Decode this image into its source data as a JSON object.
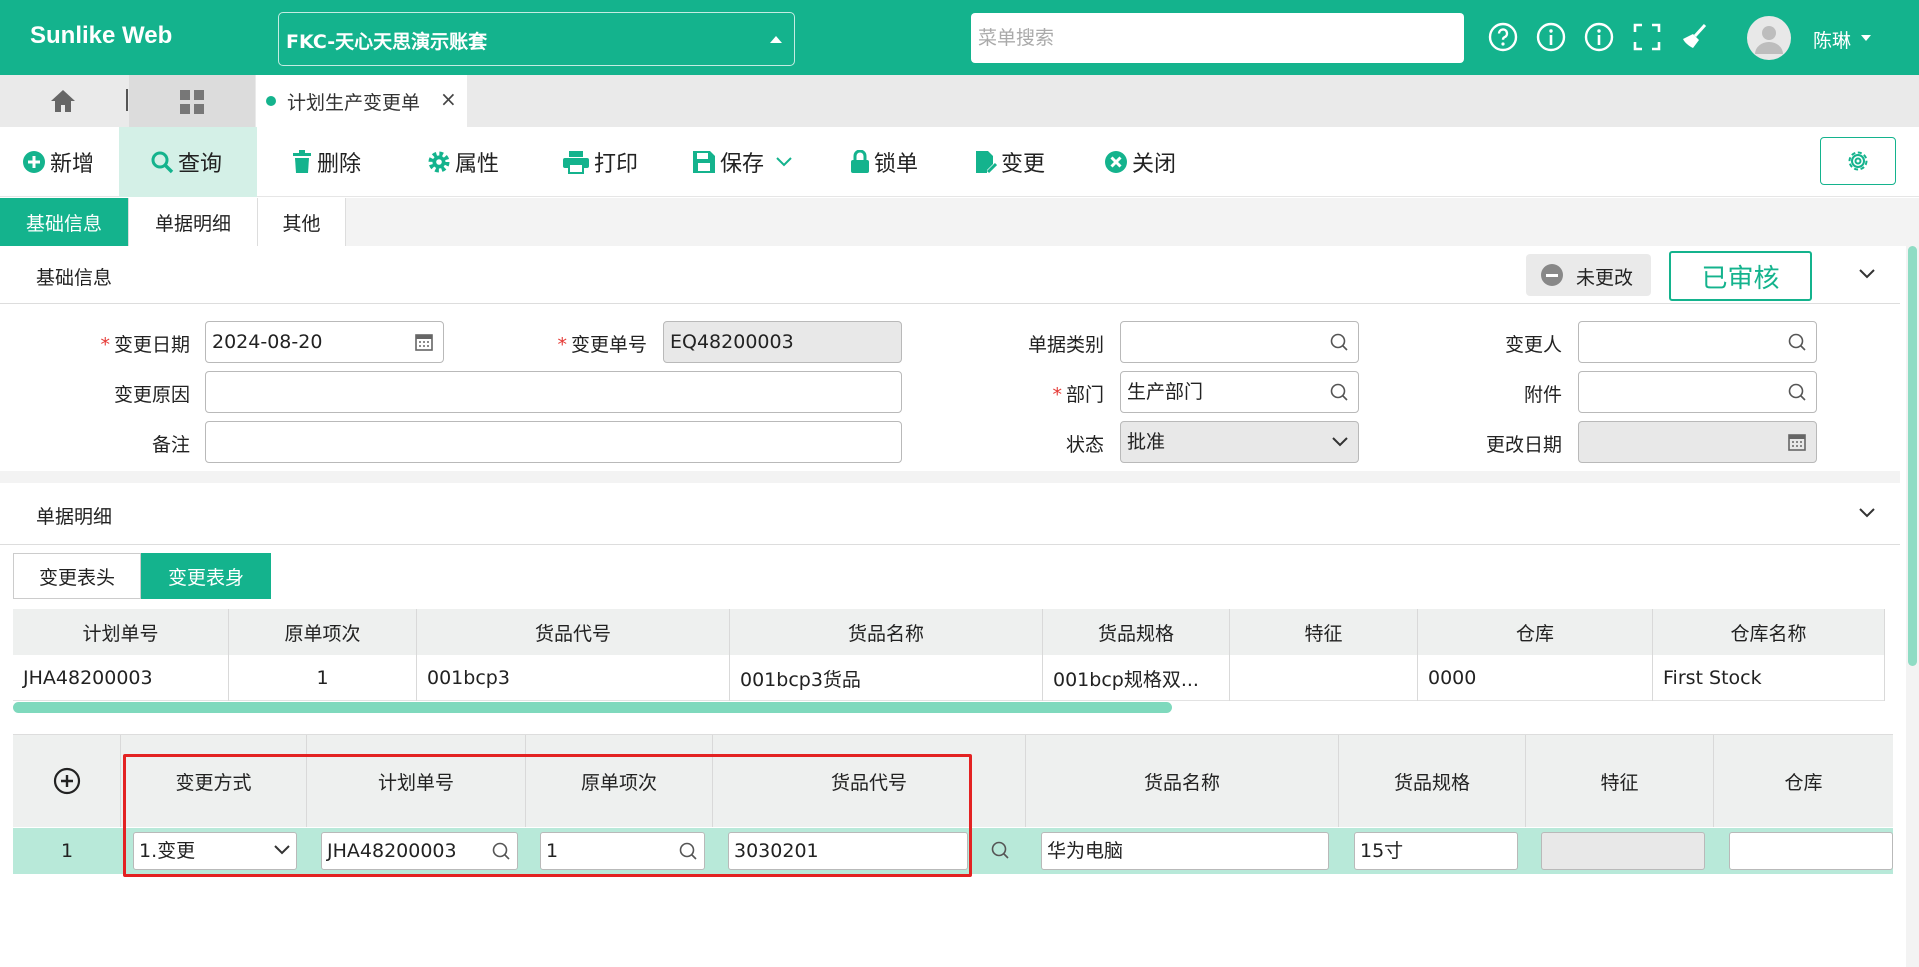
{
  "header": {
    "brand": "Sunlike Web",
    "account": "FKC-天心天思演示账套",
    "search_placeholder": "菜单搜索",
    "username": "陈琳"
  },
  "tabs": {
    "active_doc": "计划生产变更单"
  },
  "toolbar": {
    "new": "新增",
    "query": "查询",
    "delete": "删除",
    "attr": "属性",
    "print": "打印",
    "save": "保存",
    "lock": "锁单",
    "change": "变更",
    "close": "关闭"
  },
  "subtabs": [
    "基础信息",
    "单据明细",
    "其他"
  ],
  "basic": {
    "title": "基础信息",
    "unchanged": "未更改",
    "approved": "已审核",
    "labels": {
      "change_date": "变更日期",
      "change_no": "变更单号",
      "doc_type": "单据类别",
      "changer": "变更人",
      "reason": "变更原因",
      "dept": "部门",
      "attachment": "附件",
      "remark": "备注",
      "status": "状态",
      "modify_date": "更改日期"
    },
    "values": {
      "change_date": "2024-08-20",
      "change_no": "EQ48200003",
      "doc_type": "",
      "changer": "",
      "reason": "",
      "dept": "生产部门",
      "attachment": "",
      "remark": "",
      "status": "批准",
      "modify_date": ""
    }
  },
  "detail": {
    "title": "单据明细",
    "inner_tabs": [
      "变更表头",
      "变更表身"
    ],
    "head_grid": {
      "columns": [
        "计划单号",
        "原单项次",
        "货品代号",
        "货品名称",
        "货品规格",
        "特征",
        "仓库",
        "仓库名称"
      ],
      "rows": [
        [
          "JHA48200003",
          "1",
          "001bcp3",
          "001bcp3货品",
          "001bcp规格双...",
          "",
          "0000",
          "First Stock"
        ]
      ]
    },
    "body_grid": {
      "columns": [
        "变更方式",
        "计划单号",
        "原单项次",
        "货品代号",
        "货品名称",
        "货品规格",
        "特征",
        "仓库"
      ],
      "row": {
        "no": "1",
        "change_mode": "1.变更",
        "plan_no": "JHA48200003",
        "orig_item": "1",
        "goods_code": "3030201",
        "goods_name": "华为电脑",
        "goods_spec": "15寸",
        "feature": "",
        "warehouse": ""
      }
    }
  }
}
